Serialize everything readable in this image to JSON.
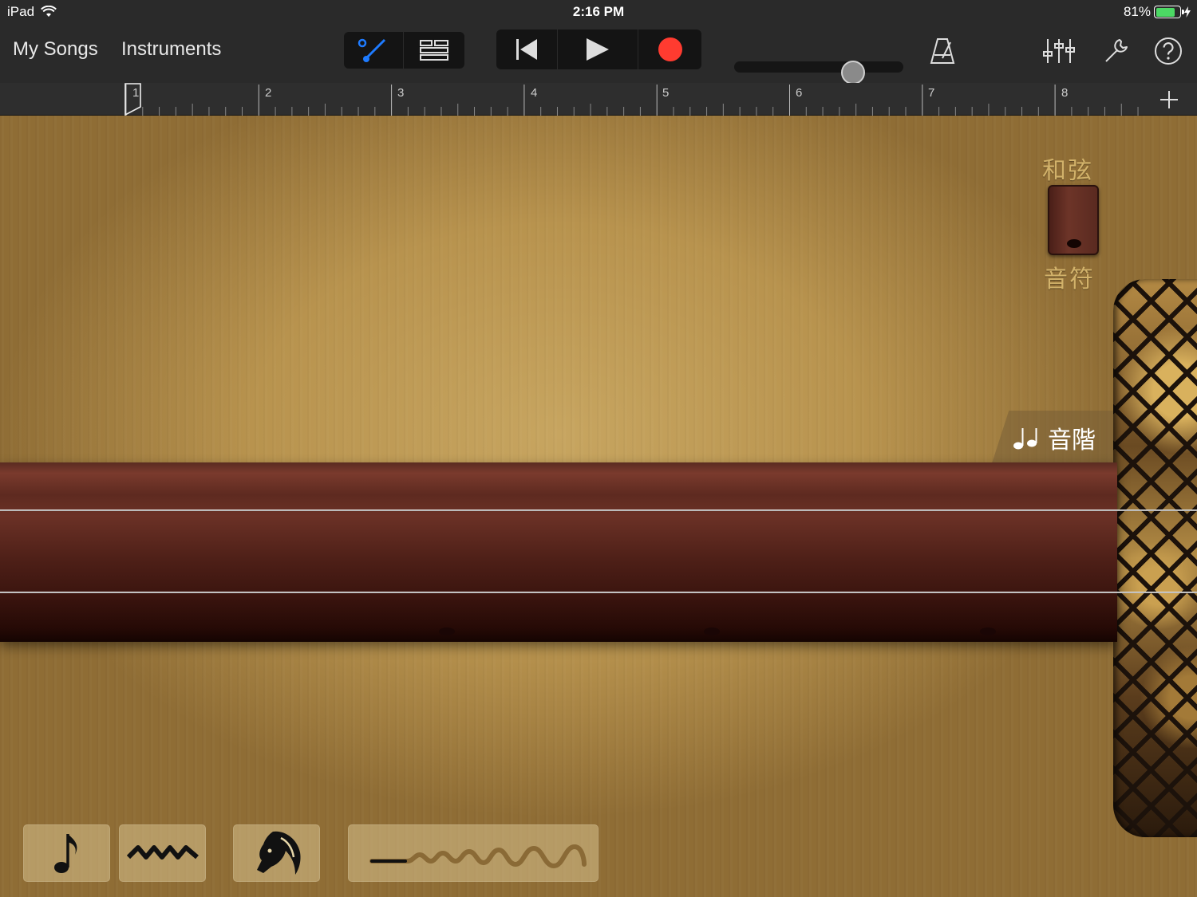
{
  "status": {
    "device": "iPad",
    "time": "2:16 PM",
    "battery": "81%"
  },
  "toolbar": {
    "my_songs": "My Songs",
    "instruments": "Instruments"
  },
  "ruler": {
    "bars": [
      "1",
      "2",
      "3",
      "4",
      "5",
      "6",
      "7",
      "8"
    ]
  },
  "instrument": {
    "chords_label": "和弦",
    "notes_label": "音符",
    "scale_label": "音階",
    "scale_icon": "double-notes-icon"
  },
  "playstyles": [
    "single-note-icon",
    "vibrato-icon",
    "horse-icon",
    "glissando-icon"
  ],
  "colors": {
    "accent_blue": "#1e7bff",
    "record_red": "#ff3b30",
    "wood": "#6b3126",
    "gold_text": "#d2b26a"
  }
}
